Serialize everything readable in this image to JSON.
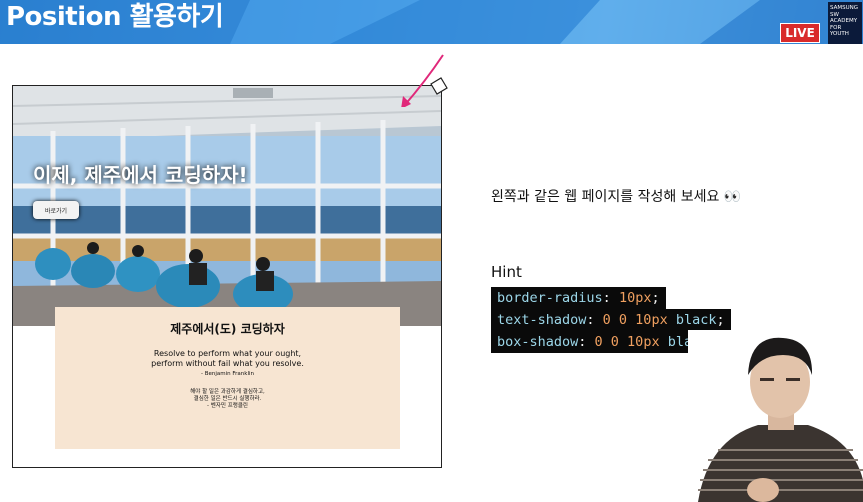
{
  "header": {
    "title": "Position 활용하기",
    "live_badge": "LIVE",
    "logo_lines": [
      "SAMSUNG",
      "SW",
      "ACADEMY",
      "FOR",
      "YOUTH"
    ]
  },
  "preview": {
    "hero_title": "이제, 제주에서 코딩하자!",
    "hero_button": "바로가기",
    "card_title": "제주에서(도) 코딩하자",
    "quote_line1": "Resolve to perform what your ought,",
    "quote_line2": "perform without fail what you resolve.",
    "quote_author": "- Benjamin Franklin",
    "kr_line1": "해야 할 일은 과감하게 결심하고,",
    "kr_line2": "결심한 일은 반드시 실행하라.",
    "kr_line3": "- 벤자민 프랭클린"
  },
  "instruction": "왼쪽과 같은 웹 페이지를 작성해 보세요 👀",
  "hint": {
    "label": "Hint",
    "lines": [
      {
        "prop": "border-radius",
        "value": "10px",
        "rest": ""
      },
      {
        "prop": "text-shadow",
        "value": "0 0 10px",
        "rest": "black"
      },
      {
        "prop": "box-shadow",
        "value": "0 0 10px",
        "rest": "black"
      }
    ]
  },
  "colors": {
    "banner": "#3d93e0",
    "live": "#d92b2b",
    "card_bg": "#f7e5d2",
    "annotation_arrow": "#e0287a"
  }
}
